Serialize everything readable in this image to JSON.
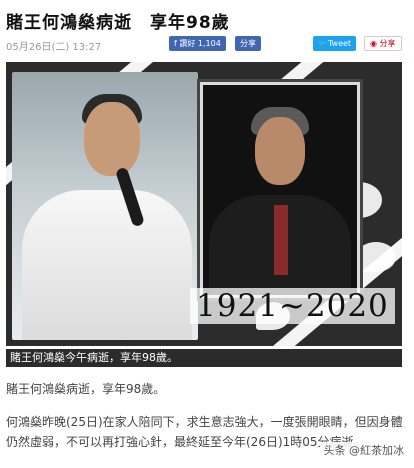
{
  "article": {
    "title": "賭王何鴻燊病逝　享年98歲",
    "date": "05月26日(二) 13:27"
  },
  "social": {
    "fb_like": "讚好 1,104",
    "fb_share": "分享",
    "tweet": "Tweet",
    "share": "分享"
  },
  "hero": {
    "years": "1921~2020",
    "caption": "賭王何鴻燊今午病逝，享年98歲。"
  },
  "content": {
    "lead": "賭王何鴻燊病逝，享年98歲。",
    "body": "何鴻燊昨晚(25日)在家人陪同下，求生意志強大，一度張開眼睛，但因身體仍然虛弱，不可以再打強心針，最終延至今年(26日)1時05分病逝。"
  },
  "watermark": "头条 @紅茶加冰",
  "colors": {
    "facebook": "#4267b2",
    "twitter": "#1da1f2",
    "share_red": "#d0021b",
    "caption_bg": "#2b2b2b"
  },
  "icons": [
    "facebook-icon",
    "twitter-icon",
    "eye-icon"
  ]
}
